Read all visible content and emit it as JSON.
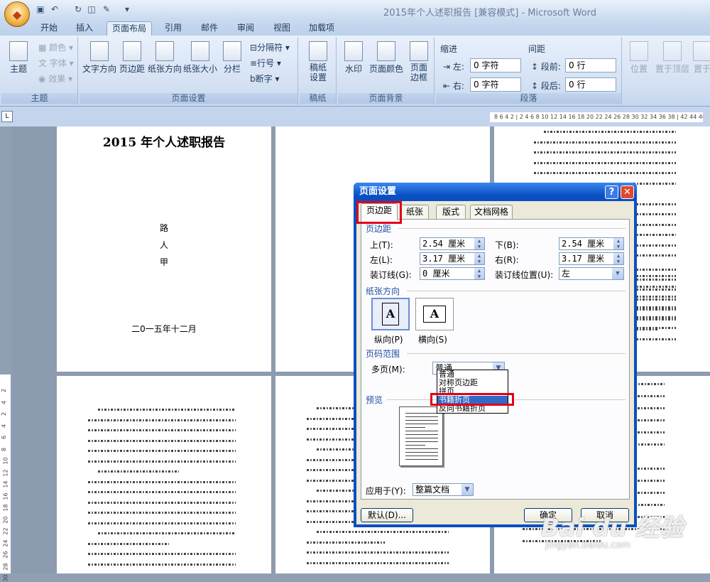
{
  "window": {
    "title": "2015年个人述职报告 [兼容模式] - Microsoft Word"
  },
  "tabs": [
    "开始",
    "插入",
    "页面布局",
    "引用",
    "邮件",
    "审阅",
    "视图",
    "加载项"
  ],
  "ribbon": {
    "theme": {
      "label": "主题",
      "color": "颜色",
      "font": "字体",
      "effect": "效果",
      "group": "主题"
    },
    "page_setup": {
      "text_dir": "文字方向",
      "margins": "页边距",
      "orientation": "纸张方向",
      "size": "纸张大小",
      "columns": "分栏",
      "breaks": "分隔符",
      "line_numbers": "行号",
      "hyphenation": "断字",
      "group": "页面设置"
    },
    "draft": {
      "label": "稿纸设置",
      "group": "稿纸"
    },
    "background": {
      "watermark": "水印",
      "page_color": "页面颜色",
      "page_border": "页面边框",
      "group": "页面背景"
    },
    "paragraph": {
      "indent": "缩进",
      "left": "左:",
      "left_val": "0 字符",
      "right": "右:",
      "right_val": "0 字符",
      "spacing": "间距",
      "before": "段前:",
      "before_val": "0 行",
      "after": "段后:",
      "after_val": "0 行",
      "group": "段落"
    },
    "arrange": {
      "position": "位置",
      "front": "置于顶层",
      "back": "置于"
    }
  },
  "ruler_h": "8 6 4 2 | 2 4 6 8 10 12 14 16 18 20 22 24 26 28 30 32 34 36 38 | 42 44 46",
  "ruler_v": [
    "2",
    "4",
    "2",
    "4",
    "6",
    "8",
    "10",
    "12",
    "14",
    "16",
    "18",
    "20",
    "22",
    "24",
    "26",
    "28",
    "30"
  ],
  "document": {
    "title": "2015 年个人述职报告",
    "author": [
      "路",
      "人",
      "甲"
    ],
    "date": "二0一五年十二月"
  },
  "dialog": {
    "title": "页面设置",
    "tabs": [
      "页边距",
      "纸张",
      "版式",
      "文档网格"
    ],
    "margins_section": "页边距",
    "top_label": "上(T):",
    "top_val": "2.54 厘米",
    "bottom_label": "下(B):",
    "bottom_val": "2.54 厘米",
    "left_label": "左(L):",
    "left_val": "3.17 厘米",
    "right_label": "右(R):",
    "right_val": "3.17 厘米",
    "gutter_label": "装订线(G):",
    "gutter_val": "0 厘米",
    "gutter_pos_label": "装订线位置(U):",
    "gutter_pos_val": "左",
    "orientation_section": "纸张方向",
    "portrait": "纵向(P)",
    "landscape": "横向(S)",
    "pages_section": "页码范围",
    "multi_label": "多页(M):",
    "multi_val": "普通",
    "multi_options": [
      "普通",
      "对称页边距",
      "拼页",
      "书籍折页",
      "反向书籍折页"
    ],
    "preview_section": "预览",
    "apply_label": "应用于(Y):",
    "apply_val": "整篇文档",
    "default_btn": "默认(D)...",
    "ok_btn": "确定",
    "cancel_btn": "取消"
  },
  "watermark": {
    "brand": "Bai du 经验",
    "url": "jingyan.baidu.com"
  }
}
